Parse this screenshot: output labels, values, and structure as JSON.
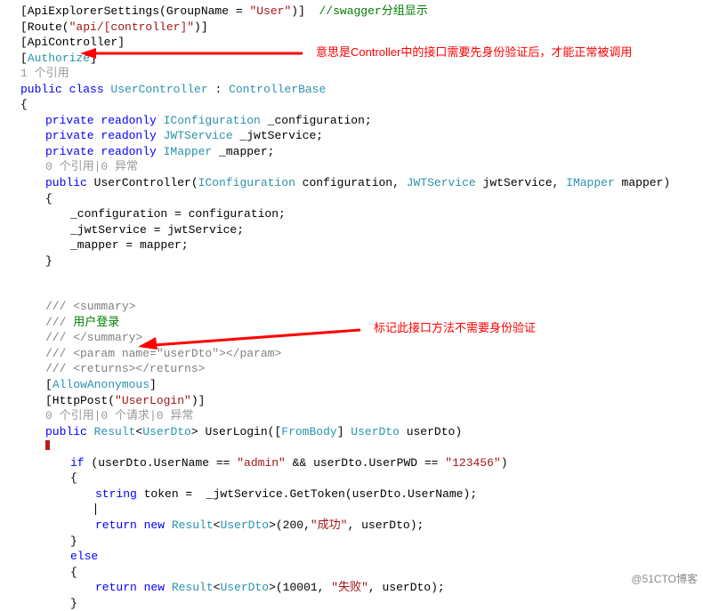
{
  "code": {
    "l1": "[ApiExplorerSettings(GroupName = ",
    "l1s": "\"User\"",
    "l1e": ")]  ",
    "l1c": "//swagger分组显示",
    "l2a": "[Route(",
    "l2s": "\"api/[controller]\"",
    "l2b": ")]",
    "l3": "[ApiController]",
    "l4a": "[",
    "l4b": "Authorize",
    "l4c": "]",
    "l5": "1 个引用",
    "l6a": "public",
    "l6b": " class",
    "l6c": " UserController",
    "l6d": " : ",
    "l6e": "ControllerBase",
    "l7": "{",
    "l8a": "private",
    "l8b": " readonly",
    "l8c": " IConfiguration",
    "l8d": " _configuration;",
    "l9a": "private",
    "l9b": " readonly",
    "l9c": " JWTService",
    "l9d": " _jwtService;",
    "l10a": "private",
    "l10b": " readonly",
    "l10c": " IMapper",
    "l10d": " _mapper;",
    "l11": "0 个引用|0 异常",
    "l12a": "public",
    "l12b": " UserController",
    "l12c": "(",
    "l12d": "IConfiguration",
    "l12e": " configuration, ",
    "l12f": "JWTService",
    "l12g": " jwtService, ",
    "l12h": "IMapper",
    "l12i": " mapper)",
    "l13": "{",
    "l14": "_configuration = configuration;",
    "l15": "_jwtService = jwtService;",
    "l16": "_mapper = mapper;",
    "l17": "}",
    "l18a": "///",
    "l18b": " <summary>",
    "l19a": "///",
    "l19b": " 用户登录",
    "l20a": "///",
    "l20b": " </summary>",
    "l21a": "///",
    "l21b": " <param name=\"",
    "l21c": "userDto",
    "l21d": "\"></param>",
    "l22a": "///",
    "l22b": " <returns></returns>",
    "l23a": "[",
    "l23b": "AllowAnonymous",
    "l23c": "]",
    "l24a": "[HttpPost(",
    "l24b": "\"UserLogin\"",
    "l24c": ")]",
    "l25": "0 个引用|0 个请求|0 异常",
    "l26a": "public",
    "l26b": " Result",
    "l26c": "<",
    "l26d": "UserDto",
    "l26e": "> UserLogin([",
    "l26f": "FromBody",
    "l26g": "] ",
    "l26h": "UserDto",
    "l26i": " userDto)",
    "l27a": "if",
    "l27b": " (userDto.UserName == ",
    "l27c": "\"admin\"",
    "l27d": " && userDto.UserPWD == ",
    "l27e": "\"123456\"",
    "l27f": ")",
    "l28": "{",
    "l29a": "string",
    "l29b": " token =  _jwtService.GetToken(userDto.UserName);",
    "l30a": "return",
    "l30b": " new",
    "l30c": " Result",
    "l30d": "<",
    "l30e": "UserDto",
    "l30f": ">(200,",
    "l30g": "\"成功\"",
    "l30h": ", userDto);",
    "l31": "}",
    "l32": "else",
    "l33": "{",
    "l34a": "return",
    "l34b": " new",
    "l34c": " Result",
    "l34d": "<",
    "l34e": "UserDto",
    "l34f": ">(10001, ",
    "l34g": "\"失败\"",
    "l34h": ", userDto);",
    "l35": "}"
  },
  "annotations": {
    "top": "意思是Controller中的接口需要先身份验证后，才能正常被调用",
    "mid": "标记此接口方法不需要身份验证"
  },
  "watermark": "@51CTO博客"
}
